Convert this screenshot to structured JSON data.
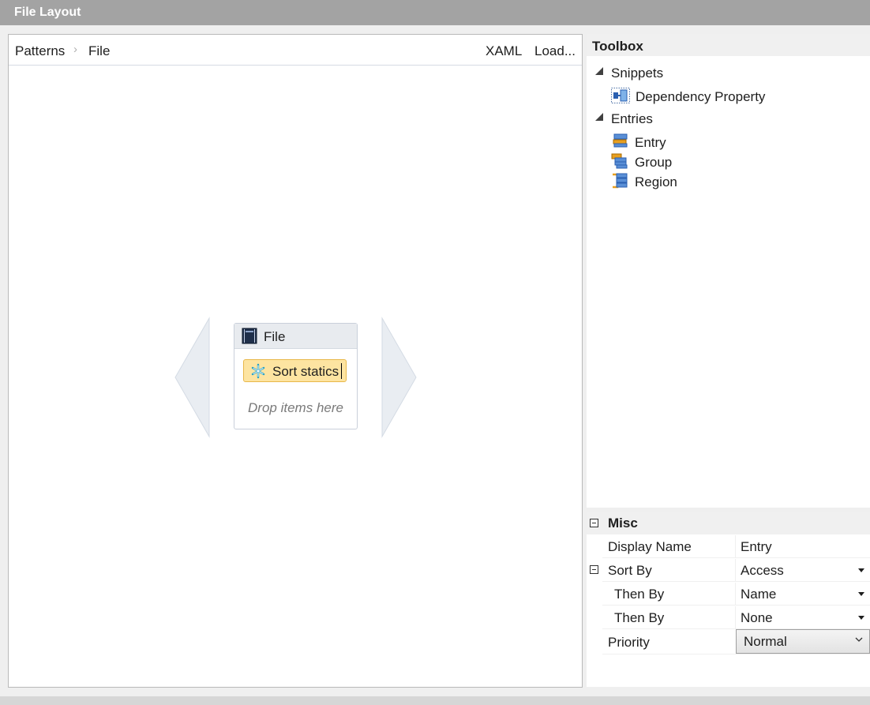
{
  "window": {
    "title": "File Layout"
  },
  "designer": {
    "breadcrumb": [
      "Patterns",
      "File"
    ],
    "actions": {
      "xaml": "XAML",
      "load": "Load..."
    },
    "file_node": {
      "title": "File",
      "entry_label": "Sort statics",
      "drop_hint": "Drop items here"
    }
  },
  "toolbox": {
    "title": "Toolbox",
    "groups": [
      {
        "label": "Snippets",
        "items": [
          {
            "label": "Dependency Property",
            "icon": "dependency-property-icon"
          }
        ]
      },
      {
        "label": "Entries",
        "items": [
          {
            "label": "Entry",
            "icon": "entry-icon"
          },
          {
            "label": "Group",
            "icon": "group-icon"
          },
          {
            "label": "Region",
            "icon": "region-icon"
          }
        ]
      }
    ]
  },
  "properties": {
    "category": "Misc",
    "rows": [
      {
        "name": "Display Name",
        "value": "Entry"
      },
      {
        "name": "Sort By",
        "value": "Access"
      },
      {
        "name": "Then By",
        "value": "Name"
      },
      {
        "name": "Then By",
        "value": "None"
      },
      {
        "name": "Priority",
        "value": "Normal"
      }
    ]
  },
  "colors": {
    "title_bar": "#a3a3a3",
    "entry_highlight": "#fde4a1",
    "entry_border": "#e8b84a",
    "node_header": "#e8ebef",
    "icon_blue": "#2a5fb0",
    "icon_orange": "#e8a020"
  }
}
